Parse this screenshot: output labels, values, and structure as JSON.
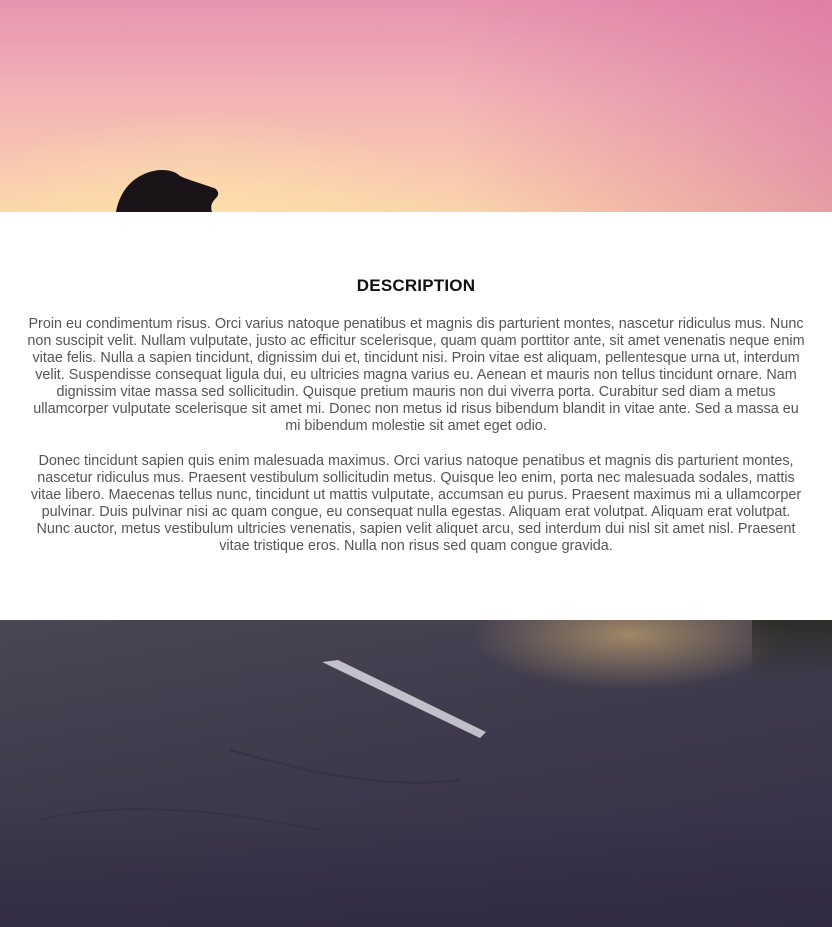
{
  "description_section": {
    "heading": "DESCRIPTION",
    "paragraph_1": "Proin eu condimentum risus. Orci varius natoque penatibus et magnis dis parturient montes, nascetur ridiculus mus. Nunc non suscipit velit. Nullam vulputate, justo ac efficitur scelerisque, quam quam porttitor ante, sit amet venenatis neque enim vitae felis. Nulla a sapien tincidunt, dignissim dui et, tincidunt nisi. Proin vitae est aliquam, pellentesque urna ut, interdum velit. Suspendisse consequat ligula dui, eu ultricies magna varius eu. Aenean et mauris non tellus tincidunt ornare. Nam dignissim vitae massa sed sollicitudin. Quisque pretium mauris non dui viverra porta. Curabitur sed diam a metus ullamcorper vulputate scelerisque sit amet mi. Donec non metus id risus bibendum blandit in vitae ante. Sed a massa eu mi bibendum molestie sit amet eget odio.",
    "paragraph_2": "Donec tincidunt sapien quis enim malesuada maximus. Orci varius natoque penatibus et magnis dis parturient montes, nascetur ridiculus mus. Praesent vestibulum sollicitudin metus. Quisque leo enim, porta nec malesuada sodales, mattis vitae libero. Maecenas tellus nunc, tincidunt ut mattis vulputate, accumsan eu purus. Praesent maximus mi a ullamcorper pulvinar. Duis pulvinar nisi ac quam congue, eu consequat nulla egestas. Aliquam erat volutpat. Aliquam erat volutpat. Nunc auctor, metus vestibulum ultricies venenatis, sapien velit aliquet arcu, sed interdum dui nisl sit amet nisl. Praesent vitae tristique eros. Nulla non risus sed quam congue gravida."
  },
  "images": {
    "top": "sunset-sky-silhouette-photo",
    "bottom": "asphalt-road-photo"
  },
  "colors": {
    "heading": "#111111",
    "body_text": "#555555",
    "background": "#ffffff"
  }
}
